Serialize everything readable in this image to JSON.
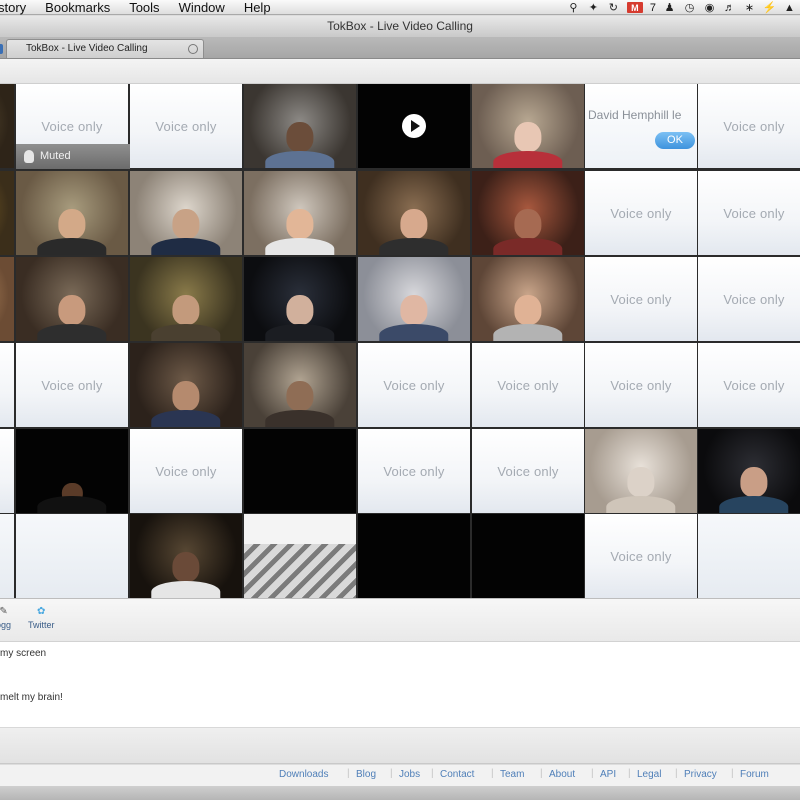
{
  "menubar": {
    "items": [
      "story",
      "Bookmarks",
      "Tools",
      "Window",
      "Help"
    ],
    "status_icons": [
      "magnifier-icon",
      "script-icon",
      "sync-icon",
      "gmail-icon",
      "user-icon",
      "clock-icon",
      "network-icon",
      "speaker-icon",
      "bluetooth-icon",
      "bolt-icon",
      "wifi-icon"
    ],
    "gmail_count": "7"
  },
  "window": {
    "title": "TokBox - Live Video Calling",
    "tab_label": "TokBox - Live Video Calling"
  },
  "grid": {
    "voice_label": "Voice only",
    "muted_label": "Muted",
    "notice_text": "David Hemphill le",
    "ok_label": "OK"
  },
  "share": {
    "items": [
      "ogg",
      "Twitter"
    ]
  },
  "chat": {
    "messages": [
      "my screen",
      "melt my brain!"
    ]
  },
  "footer": {
    "links": [
      "Downloads",
      "Blog",
      "Jobs",
      "Contact",
      "Team",
      "About",
      "API",
      "Legal",
      "Privacy",
      "Forum"
    ]
  },
  "colors": {
    "accent": "#3e93dd",
    "link": "#4f7fb8",
    "voice_text": "#a4aab2"
  }
}
